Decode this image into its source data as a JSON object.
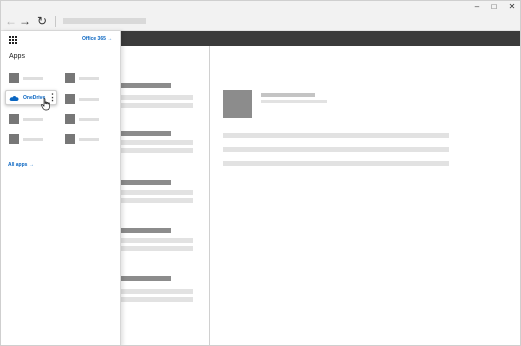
{
  "window": {
    "controls": {
      "minimize": "–",
      "maximize": "□",
      "close": "✕"
    }
  },
  "toolbar": {
    "back_icon": "←",
    "forward_icon": "→",
    "refresh_icon": "↻"
  },
  "launcher": {
    "office_link": "Office 365 →",
    "apps_heading": "Apps",
    "onedrive_label": "OneDrive",
    "more_options_icon": "⋮",
    "all_apps_link": "All apps →"
  },
  "colors": {
    "suite_bar": "#3b3b3b",
    "accent": "#0a66c2",
    "onedrive_cloud": "#0a66c2"
  }
}
